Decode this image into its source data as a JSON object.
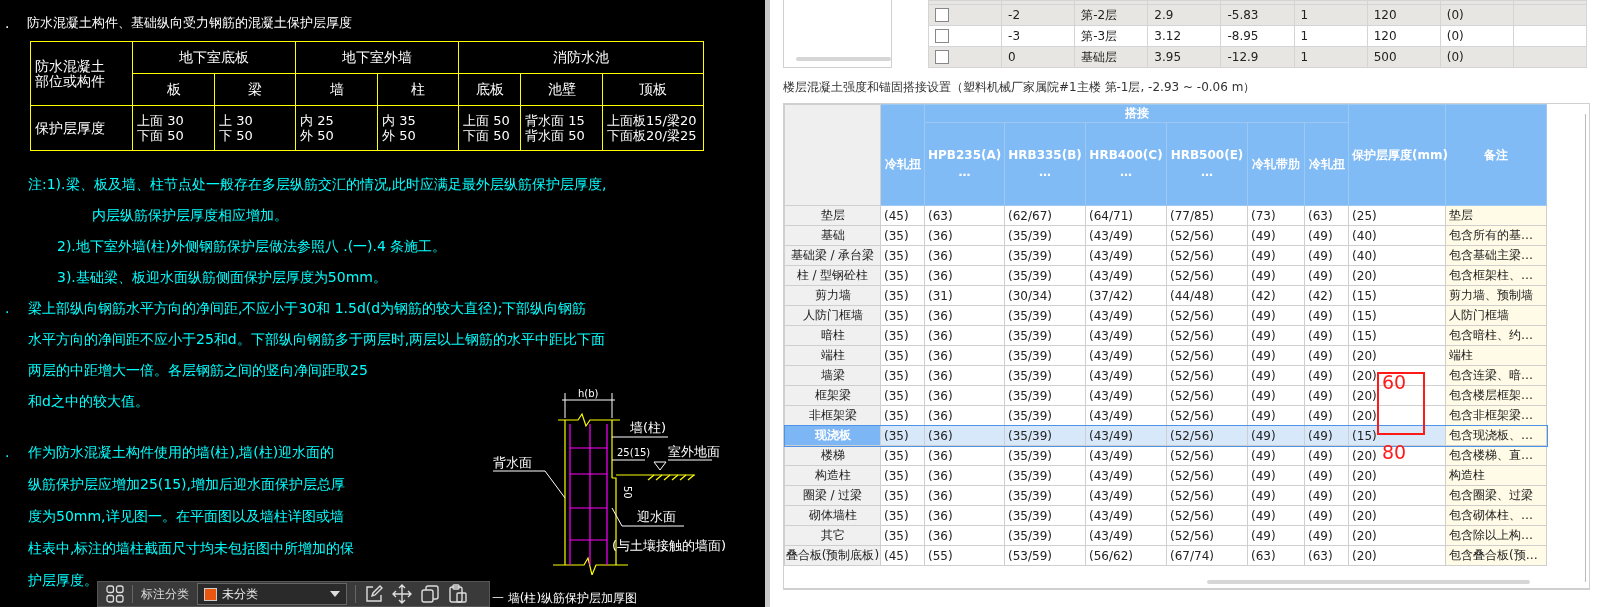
{
  "drawing": {
    "title": {
      "marker": ".",
      "text": "防水混凝土构件、基础纵向受力钢筋的混凝土保护层厚度"
    },
    "cover_table": {
      "corner": [
        "防水混凝土",
        "部位或构件"
      ],
      "groups": [
        {
          "label": "地下室底板",
          "columns": [
            "板",
            "梁"
          ]
        },
        {
          "label": "地下室外墙",
          "columns": [
            "墙",
            "柱"
          ]
        },
        {
          "label": "消防水池",
          "columns": [
            "底板",
            "池壁",
            "顶板"
          ]
        }
      ],
      "row_label": "保护层厚度",
      "values": [
        "上面 30\n下面 50",
        "上 30\n下 50",
        "内 25\n外 50",
        "内 35\n外 50",
        "上面 50\n下面 50",
        "背水面 15\n背水面 50",
        "上面板15/梁20\n下面板20/梁25"
      ]
    },
    "notes": [
      {
        "kind": "lead",
        "text": "注:1).梁、板及墙、柱节点处一般存在多层纵筋交汇的情况,此时应满足最外层纵筋保护层厚度,"
      },
      {
        "kind": "wrap",
        "text": "内层纵筋保护层厚度相应增加。"
      },
      {
        "kind": "sub",
        "text": "2).地下室外墙(柱)外侧钢筋保护层做法参照八 .(一).4 条施工。"
      },
      {
        "kind": "sub",
        "text": "3).基础梁、板迎水面纵筋侧面保护层厚度为50mm。"
      }
    ],
    "items": [
      {
        "marker": ".",
        "lines": [
          "梁上部纵向钢筋水平方向的净间距,不应小于30和 1.5d(d为钢筋的较大直径);下部纵向钢筋",
          "水平方向的净间距不应小于25和d。下部纵向钢筋多于两层时,两层以上钢筋的水平中距比下面",
          "两层的中距增大一倍。各层钢筋之间的竖向净间距取25",
          "和d之中的较大值。"
        ]
      },
      {
        "marker": ".",
        "lines": [
          "作为防水混凝土构件使用的墙(柱),墙(柱)迎水面的",
          "纵筋保护层应增加25(15),增加后迎水面保护层总厚",
          "度为50mm,详见图一。在平面图以及墙柱详图或墙",
          "柱表中,标注的墙柱截面尺寸均未包括图中所增加的保",
          "护层厚度。"
        ]
      }
    ],
    "diagram": {
      "width_label": "h(b)",
      "wall_label": "墙(柱)",
      "extra_label": "25(15)",
      "ground_label": "室外地面",
      "back_face_label": "背水面",
      "depth_label": "50",
      "water_face_label": "迎水面",
      "water_face_note": "(与土壤接触的墙面)",
      "caption": "一 墙(柱)纵筋保护层加厚图"
    },
    "toolbar": {
      "category_label": "标注分类",
      "dropdown": {
        "value": "未分类",
        "color": "#e8560f"
      }
    }
  },
  "floors_table": {
    "rows": [
      {
        "checked": false,
        "cells": [
          "-2",
          "第-2层",
          "2.9",
          "-5.83",
          "1",
          "120",
          "(0)"
        ]
      },
      {
        "checked": false,
        "cells": [
          "-3",
          "第-3层",
          "3.12",
          "-8.95",
          "1",
          "120",
          "(0)"
        ]
      },
      {
        "checked": false,
        "cells": [
          "0",
          "基础层",
          "3.95",
          "-12.9",
          "1",
          "500",
          "(0)"
        ]
      }
    ]
  },
  "settings_caption": "楼层混凝土强度和锚固搭接设置（塑料机械厂家属院#1主楼  第-1层, -2.93 ~ -0.06 m）",
  "settings_table": {
    "group_label": "搭接",
    "first_column": "冷轧扭",
    "lap_columns": [
      "HPB235(A)\n…",
      "HRB335(B)\n…",
      "HRB400(C)\n…",
      "HRB500(E)\n…",
      "冷轧带肋",
      "冷轧扭"
    ],
    "cover_column": "保护层厚度(mm)",
    "note_column": "备注",
    "rows": [
      {
        "label": "垫层",
        "selected": false,
        "cells": [
          "(45)",
          "(63)",
          "(62/67)",
          "(64/71)",
          "(77/85)",
          "(73)",
          "(63)",
          "(25)"
        ],
        "note": "垫层"
      },
      {
        "label": "基础",
        "selected": false,
        "cells": [
          "(35)",
          "(36)",
          "(35/39)",
          "(43/49)",
          "(52/56)",
          "(49)",
          "(49)",
          "(40)"
        ],
        "note": "包含所有的基…"
      },
      {
        "label": "基础梁 / 承台梁",
        "selected": false,
        "cells": [
          "(35)",
          "(36)",
          "(35/39)",
          "(43/49)",
          "(52/56)",
          "(49)",
          "(49)",
          "(40)"
        ],
        "note": "包含基础主梁…"
      },
      {
        "label": "柱 / 型钢砼柱",
        "selected": false,
        "cells": [
          "(35)",
          "(36)",
          "(35/39)",
          "(43/49)",
          "(52/56)",
          "(49)",
          "(49)",
          "(20)"
        ],
        "note": "包含框架柱、…"
      },
      {
        "label": "剪力墙",
        "selected": false,
        "cells": [
          "(35)",
          "(31)",
          "(30/34)",
          "(37/42)",
          "(44/48)",
          "(42)",
          "(42)",
          "(15)"
        ],
        "note": "剪力墙、预制墙"
      },
      {
        "label": "人防门框墙",
        "selected": false,
        "cells": [
          "(35)",
          "(36)",
          "(35/39)",
          "(43/49)",
          "(52/56)",
          "(49)",
          "(49)",
          "(15)"
        ],
        "note": "人防门框墙"
      },
      {
        "label": "暗柱",
        "selected": false,
        "cells": [
          "(35)",
          "(36)",
          "(35/39)",
          "(43/49)",
          "(52/56)",
          "(49)",
          "(49)",
          "(15)"
        ],
        "note": "包含暗柱、约…"
      },
      {
        "label": "端柱",
        "selected": false,
        "cells": [
          "(35)",
          "(36)",
          "(35/39)",
          "(43/49)",
          "(52/56)",
          "(49)",
          "(49)",
          "(20)"
        ],
        "note": "端柱"
      },
      {
        "label": "墙梁",
        "selected": false,
        "cells": [
          "(35)",
          "(36)",
          "(35/39)",
          "(43/49)",
          "(52/56)",
          "(49)",
          "(49)",
          "(20)"
        ],
        "note": "包含连梁、暗…"
      },
      {
        "label": "框架梁",
        "selected": false,
        "cells": [
          "(35)",
          "(36)",
          "(35/39)",
          "(43/49)",
          "(52/56)",
          "(49)",
          "(49)",
          "(20)"
        ],
        "note": "包含楼层框架…"
      },
      {
        "label": "非框架梁",
        "selected": false,
        "cells": [
          "(35)",
          "(36)",
          "(35/39)",
          "(43/49)",
          "(52/56)",
          "(49)",
          "(49)",
          "(20)"
        ],
        "note": "包含非框架梁…"
      },
      {
        "label": "现浇板",
        "selected": true,
        "cells": [
          "(35)",
          "(36)",
          "(35/39)",
          "(43/49)",
          "(52/56)",
          "(49)",
          "(49)",
          "(15)"
        ],
        "note": "包含现浇板、…"
      },
      {
        "label": "楼梯",
        "selected": false,
        "cells": [
          "(35)",
          "(36)",
          "(35/39)",
          "(43/49)",
          "(52/56)",
          "(49)",
          "(49)",
          "(20)"
        ],
        "note": "包含楼梯、直…"
      },
      {
        "label": "构造柱",
        "selected": false,
        "cells": [
          "(35)",
          "(36)",
          "(35/39)",
          "(43/49)",
          "(52/56)",
          "(49)",
          "(49)",
          "(20)"
        ],
        "note": "构造柱"
      },
      {
        "label": "圈梁 / 过梁",
        "selected": false,
        "cells": [
          "(35)",
          "(36)",
          "(35/39)",
          "(43/49)",
          "(52/56)",
          "(49)",
          "(49)",
          "(20)"
        ],
        "note": "包含圈梁、过梁"
      },
      {
        "label": "砌体墙柱",
        "selected": false,
        "cells": [
          "(35)",
          "(36)",
          "(35/39)",
          "(43/49)",
          "(52/56)",
          "(49)",
          "(49)",
          "(20)"
        ],
        "note": "包含砌体柱、…"
      },
      {
        "label": "其它",
        "selected": false,
        "cells": [
          "(35)",
          "(36)",
          "(35/39)",
          "(43/49)",
          "(52/56)",
          "(49)",
          "(49)",
          "(20)"
        ],
        "note": "包含除以上构…"
      },
      {
        "label": "叠合板(预制底板)",
        "selected": false,
        "cells": [
          "(45)",
          "(55)",
          "(53/59)",
          "(56/62)",
          "(67/74)",
          "(63)",
          "(63)",
          "(20)"
        ],
        "note": "包含叠合板(预…"
      }
    ]
  },
  "annotation": {
    "box_text": "60",
    "below_text": "80"
  }
}
